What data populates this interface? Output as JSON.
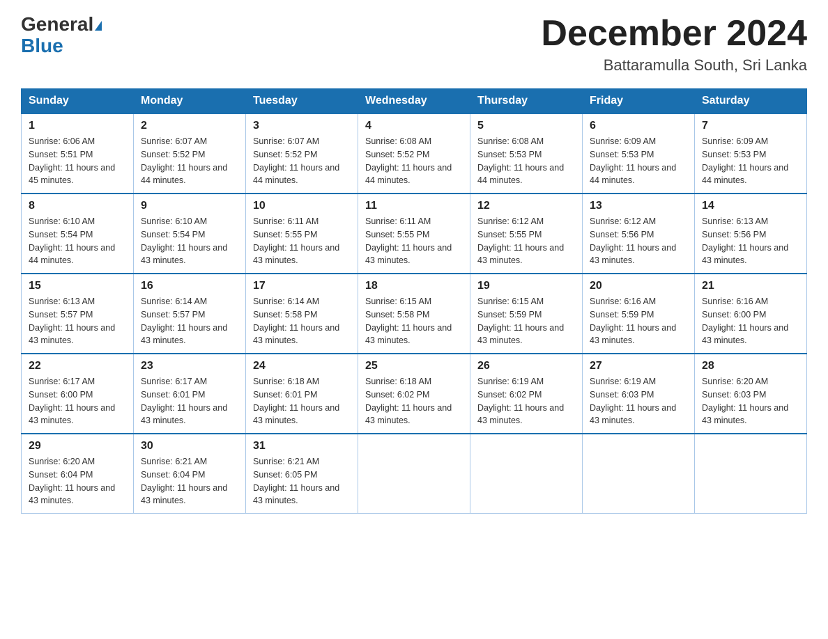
{
  "header": {
    "logo_general": "General",
    "logo_blue": "Blue",
    "title": "December 2024",
    "subtitle": "Battaramulla South, Sri Lanka"
  },
  "days_of_week": [
    "Sunday",
    "Monday",
    "Tuesday",
    "Wednesday",
    "Thursday",
    "Friday",
    "Saturday"
  ],
  "weeks": [
    [
      {
        "day": "1",
        "sunrise": "Sunrise: 6:06 AM",
        "sunset": "Sunset: 5:51 PM",
        "daylight": "Daylight: 11 hours and 45 minutes."
      },
      {
        "day": "2",
        "sunrise": "Sunrise: 6:07 AM",
        "sunset": "Sunset: 5:52 PM",
        "daylight": "Daylight: 11 hours and 44 minutes."
      },
      {
        "day": "3",
        "sunrise": "Sunrise: 6:07 AM",
        "sunset": "Sunset: 5:52 PM",
        "daylight": "Daylight: 11 hours and 44 minutes."
      },
      {
        "day": "4",
        "sunrise": "Sunrise: 6:08 AM",
        "sunset": "Sunset: 5:52 PM",
        "daylight": "Daylight: 11 hours and 44 minutes."
      },
      {
        "day": "5",
        "sunrise": "Sunrise: 6:08 AM",
        "sunset": "Sunset: 5:53 PM",
        "daylight": "Daylight: 11 hours and 44 minutes."
      },
      {
        "day": "6",
        "sunrise": "Sunrise: 6:09 AM",
        "sunset": "Sunset: 5:53 PM",
        "daylight": "Daylight: 11 hours and 44 minutes."
      },
      {
        "day": "7",
        "sunrise": "Sunrise: 6:09 AM",
        "sunset": "Sunset: 5:53 PM",
        "daylight": "Daylight: 11 hours and 44 minutes."
      }
    ],
    [
      {
        "day": "8",
        "sunrise": "Sunrise: 6:10 AM",
        "sunset": "Sunset: 5:54 PM",
        "daylight": "Daylight: 11 hours and 44 minutes."
      },
      {
        "day": "9",
        "sunrise": "Sunrise: 6:10 AM",
        "sunset": "Sunset: 5:54 PM",
        "daylight": "Daylight: 11 hours and 43 minutes."
      },
      {
        "day": "10",
        "sunrise": "Sunrise: 6:11 AM",
        "sunset": "Sunset: 5:55 PM",
        "daylight": "Daylight: 11 hours and 43 minutes."
      },
      {
        "day": "11",
        "sunrise": "Sunrise: 6:11 AM",
        "sunset": "Sunset: 5:55 PM",
        "daylight": "Daylight: 11 hours and 43 minutes."
      },
      {
        "day": "12",
        "sunrise": "Sunrise: 6:12 AM",
        "sunset": "Sunset: 5:55 PM",
        "daylight": "Daylight: 11 hours and 43 minutes."
      },
      {
        "day": "13",
        "sunrise": "Sunrise: 6:12 AM",
        "sunset": "Sunset: 5:56 PM",
        "daylight": "Daylight: 11 hours and 43 minutes."
      },
      {
        "day": "14",
        "sunrise": "Sunrise: 6:13 AM",
        "sunset": "Sunset: 5:56 PM",
        "daylight": "Daylight: 11 hours and 43 minutes."
      }
    ],
    [
      {
        "day": "15",
        "sunrise": "Sunrise: 6:13 AM",
        "sunset": "Sunset: 5:57 PM",
        "daylight": "Daylight: 11 hours and 43 minutes."
      },
      {
        "day": "16",
        "sunrise": "Sunrise: 6:14 AM",
        "sunset": "Sunset: 5:57 PM",
        "daylight": "Daylight: 11 hours and 43 minutes."
      },
      {
        "day": "17",
        "sunrise": "Sunrise: 6:14 AM",
        "sunset": "Sunset: 5:58 PM",
        "daylight": "Daylight: 11 hours and 43 minutes."
      },
      {
        "day": "18",
        "sunrise": "Sunrise: 6:15 AM",
        "sunset": "Sunset: 5:58 PM",
        "daylight": "Daylight: 11 hours and 43 minutes."
      },
      {
        "day": "19",
        "sunrise": "Sunrise: 6:15 AM",
        "sunset": "Sunset: 5:59 PM",
        "daylight": "Daylight: 11 hours and 43 minutes."
      },
      {
        "day": "20",
        "sunrise": "Sunrise: 6:16 AM",
        "sunset": "Sunset: 5:59 PM",
        "daylight": "Daylight: 11 hours and 43 minutes."
      },
      {
        "day": "21",
        "sunrise": "Sunrise: 6:16 AM",
        "sunset": "Sunset: 6:00 PM",
        "daylight": "Daylight: 11 hours and 43 minutes."
      }
    ],
    [
      {
        "day": "22",
        "sunrise": "Sunrise: 6:17 AM",
        "sunset": "Sunset: 6:00 PM",
        "daylight": "Daylight: 11 hours and 43 minutes."
      },
      {
        "day": "23",
        "sunrise": "Sunrise: 6:17 AM",
        "sunset": "Sunset: 6:01 PM",
        "daylight": "Daylight: 11 hours and 43 minutes."
      },
      {
        "day": "24",
        "sunrise": "Sunrise: 6:18 AM",
        "sunset": "Sunset: 6:01 PM",
        "daylight": "Daylight: 11 hours and 43 minutes."
      },
      {
        "day": "25",
        "sunrise": "Sunrise: 6:18 AM",
        "sunset": "Sunset: 6:02 PM",
        "daylight": "Daylight: 11 hours and 43 minutes."
      },
      {
        "day": "26",
        "sunrise": "Sunrise: 6:19 AM",
        "sunset": "Sunset: 6:02 PM",
        "daylight": "Daylight: 11 hours and 43 minutes."
      },
      {
        "day": "27",
        "sunrise": "Sunrise: 6:19 AM",
        "sunset": "Sunset: 6:03 PM",
        "daylight": "Daylight: 11 hours and 43 minutes."
      },
      {
        "day": "28",
        "sunrise": "Sunrise: 6:20 AM",
        "sunset": "Sunset: 6:03 PM",
        "daylight": "Daylight: 11 hours and 43 minutes."
      }
    ],
    [
      {
        "day": "29",
        "sunrise": "Sunrise: 6:20 AM",
        "sunset": "Sunset: 6:04 PM",
        "daylight": "Daylight: 11 hours and 43 minutes."
      },
      {
        "day": "30",
        "sunrise": "Sunrise: 6:21 AM",
        "sunset": "Sunset: 6:04 PM",
        "daylight": "Daylight: 11 hours and 43 minutes."
      },
      {
        "day": "31",
        "sunrise": "Sunrise: 6:21 AM",
        "sunset": "Sunset: 6:05 PM",
        "daylight": "Daylight: 11 hours and 43 minutes."
      },
      null,
      null,
      null,
      null
    ]
  ]
}
